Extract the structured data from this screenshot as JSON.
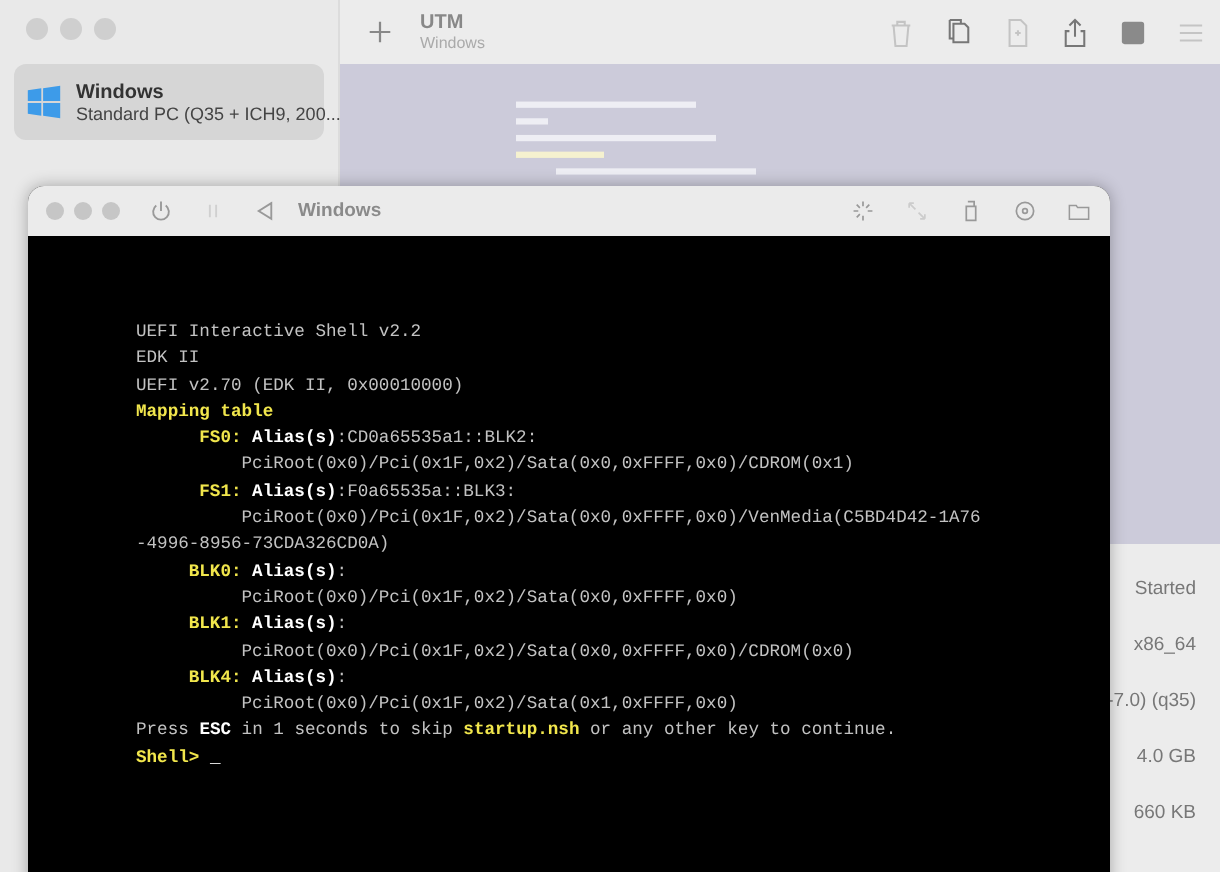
{
  "main_window": {
    "title": "UTM",
    "subtitle": "Windows",
    "sidebar": {
      "items": [
        {
          "name": "Windows",
          "description": "Standard PC (Q35 + ICH9, 200...",
          "selected": true
        }
      ]
    },
    "details": [
      "Started",
      "x86_64",
      "-7.0) (q35)",
      "4.0 GB",
      "660 KB"
    ]
  },
  "vm_window": {
    "title": "Windows",
    "console": {
      "lines": [
        {
          "kind": "text",
          "segments": [
            {
              "text": "UEFI Interactive Shell v2.2",
              "kind": "plain"
            }
          ]
        },
        {
          "kind": "text",
          "segments": [
            {
              "text": "EDK II",
              "kind": "plain"
            }
          ]
        },
        {
          "kind": "text",
          "segments": [
            {
              "text": "UEFI v2.70 (EDK II, 0x00010000)",
              "kind": "plain"
            }
          ]
        },
        {
          "kind": "text",
          "segments": [
            {
              "text": "Mapping table",
              "kind": "highlight"
            }
          ]
        },
        {
          "kind": "device",
          "segments": [
            {
              "text": "FS0:",
              "kind": "highlight"
            },
            {
              "text": " Alias(s)",
              "kind": "bright"
            },
            {
              "text": ":CD0a65535a1::BLK2:",
              "kind": "plain"
            }
          ]
        },
        {
          "kind": "path",
          "segments": [
            {
              "text": "PciRoot(0x0)/Pci(0x1F,0x2)/Sata(0x0,0xFFFF,0x0)/CDROM(0x1)",
              "kind": "plain"
            }
          ]
        },
        {
          "kind": "device",
          "segments": [
            {
              "text": "FS1:",
              "kind": "highlight"
            },
            {
              "text": " Alias(s)",
              "kind": "bright"
            },
            {
              "text": ":F0a65535a::BLK3:",
              "kind": "plain"
            }
          ]
        },
        {
          "kind": "path",
          "segments": [
            {
              "text": "PciRoot(0x0)/Pci(0x1F,0x2)/Sata(0x0,0xFFFF,0x0)/VenMedia(C5BD4D42-1A76",
              "kind": "plain"
            }
          ]
        },
        {
          "kind": "text",
          "segments": [
            {
              "text": "-4996-8956-73CDA326CD0A)",
              "kind": "plain"
            }
          ]
        },
        {
          "kind": "device",
          "segments": [
            {
              "text": "BLK0:",
              "kind": "highlight"
            },
            {
              "text": " Alias(s)",
              "kind": "bright"
            },
            {
              "text": ":",
              "kind": "plain"
            }
          ]
        },
        {
          "kind": "path",
          "segments": [
            {
              "text": "PciRoot(0x0)/Pci(0x1F,0x2)/Sata(0x0,0xFFFF,0x0)",
              "kind": "plain"
            }
          ]
        },
        {
          "kind": "device",
          "segments": [
            {
              "text": "BLK1:",
              "kind": "highlight"
            },
            {
              "text": " Alias(s)",
              "kind": "bright"
            },
            {
              "text": ":",
              "kind": "plain"
            }
          ]
        },
        {
          "kind": "path",
          "segments": [
            {
              "text": "PciRoot(0x0)/Pci(0x1F,0x2)/Sata(0x0,0xFFFF,0x0)/CDROM(0x0)",
              "kind": "plain"
            }
          ]
        },
        {
          "kind": "device",
          "segments": [
            {
              "text": "BLK4:",
              "kind": "highlight"
            },
            {
              "text": " Alias(s)",
              "kind": "bright"
            },
            {
              "text": ":",
              "kind": "plain"
            }
          ]
        },
        {
          "kind": "path",
          "segments": [
            {
              "text": "PciRoot(0x0)/Pci(0x1F,0x2)/Sata(0x1,0xFFFF,0x0)",
              "kind": "plain"
            }
          ]
        },
        {
          "kind": "text",
          "segments": [
            {
              "text": "Press ",
              "kind": "plain"
            },
            {
              "text": "ESC",
              "kind": "bright"
            },
            {
              "text": " in 1 seconds to skip ",
              "kind": "plain"
            },
            {
              "text": "startup.nsh",
              "kind": "highlight"
            },
            {
              "text": " or any other key to continue.",
              "kind": "plain"
            }
          ]
        },
        {
          "kind": "text",
          "segments": [
            {
              "text": "Shell> ",
              "kind": "highlight"
            },
            {
              "text": "_",
              "kind": "bright"
            }
          ]
        }
      ]
    }
  }
}
